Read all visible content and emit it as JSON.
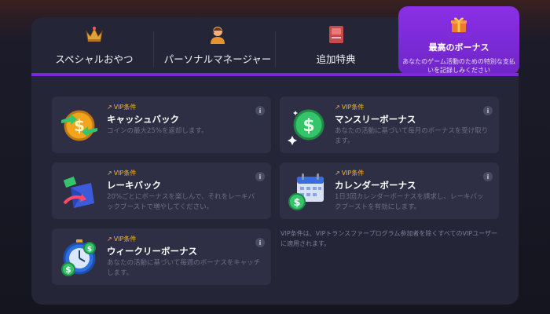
{
  "tabs": [
    {
      "label": "スペシャルおやつ",
      "icon": "crown-icon"
    },
    {
      "label": "パーソナルマネージャー",
      "icon": "manager-icon"
    },
    {
      "label": "追加特典",
      "icon": "gift-card-icon"
    }
  ],
  "active_tab": {
    "label": "最高のボーナス",
    "subtitle": "あなたのゲーム活動のための特別な支払いを記録しみください",
    "icon": "gift-box-icon"
  },
  "vip_label": "VIP条件",
  "cards": [
    {
      "title": "キャッシュバック",
      "desc": "コインの最大25%を返却します。"
    },
    {
      "title": "マンスリーボーナス",
      "desc": "あなたの活動に基づいて毎月のボーナスを受け取ります。"
    },
    {
      "title": "レーキバック",
      "desc": "20%ごとにボーナスを楽しんで、それをレーキバックブーストで増やしてください。"
    },
    {
      "title": "カレンダーボーナス",
      "desc": "1日3回カレンダーボーナスを請求し、レーキバックブーストを有効にします。"
    },
    {
      "title": "ウィークリーボーナス",
      "desc": "あなたの活動に基づいて毎週のボーナスをキャッチします。"
    }
  ],
  "note": "VIP条件は、VIPトランスファープログラム参加者を除くすべてのVIPユーザーに適用されます。",
  "colors": {
    "accent": "#7c2ad6",
    "vip": "#f6b53a",
    "panel": "#242537",
    "card": "#2e2f44"
  }
}
